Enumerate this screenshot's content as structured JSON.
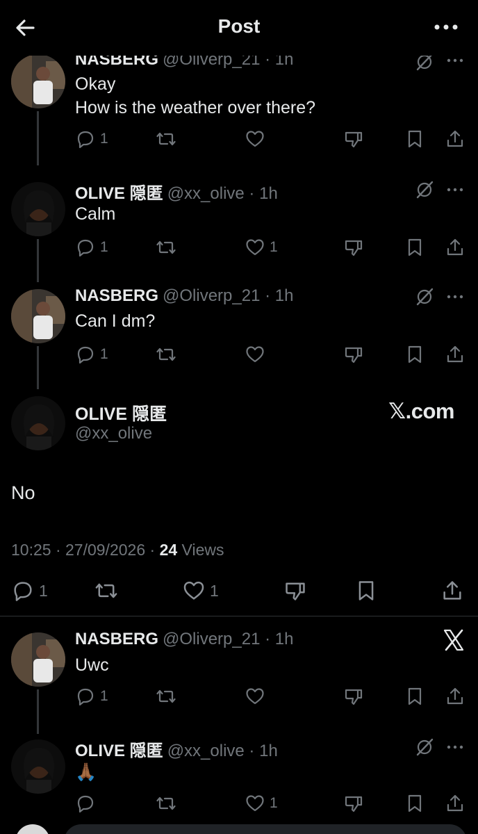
{
  "header": {
    "title": "Post"
  },
  "posts": [
    {
      "name": "NASBERG",
      "handle": "@Oliverp_21",
      "time": "1h",
      "lines": [
        "Okay",
        "How is the weather over there?"
      ],
      "replies": "1",
      "reposts": "",
      "likes": ""
    },
    {
      "name": "OLIVE 隠匿",
      "handle": "@xx_olive",
      "time": "1h",
      "lines": [
        "Calm"
      ],
      "replies": "1",
      "reposts": "",
      "likes": "1"
    },
    {
      "name": "NASBERG",
      "handle": "@Oliverp_21",
      "time": "1h",
      "lines": [
        "Can I dm?"
      ],
      "replies": "1",
      "reposts": "",
      "likes": ""
    }
  ],
  "main_post": {
    "name": "OLIVE 隠匿",
    "handle": "@xx_olive",
    "watermark": "𝕏.com",
    "text": "No",
    "timestamp": "10:25 · 27/09/2026 · ",
    "views_count": "24",
    "views_label": " Views",
    "replies": "1",
    "likes": "1"
  },
  "replies_below": [
    {
      "name": "NASBERG",
      "handle": "@Oliverp_21",
      "time": "1h",
      "text": "Uwc",
      "replies": "1",
      "likes": ""
    },
    {
      "name": "OLIVE 隠匿",
      "handle": "@xx_olive",
      "time": "1h",
      "text": "🙏🏾",
      "replies": "",
      "likes": "1"
    }
  ],
  "separator": "·",
  "icons": {
    "back": "back-arrow-icon",
    "more": "more-horizontal-icon",
    "reply": "reply-icon",
    "repost": "repost-icon",
    "like": "heart-icon",
    "downvote": "downvote-icon",
    "bookmark": "bookmark-icon",
    "share": "share-icon",
    "grok": "grok-icon",
    "x_logo": "x-logo-icon"
  },
  "colors": {
    "background": "#000000",
    "text": "#e7e9ea",
    "muted": "#71767b",
    "divider": "#2f3336"
  }
}
